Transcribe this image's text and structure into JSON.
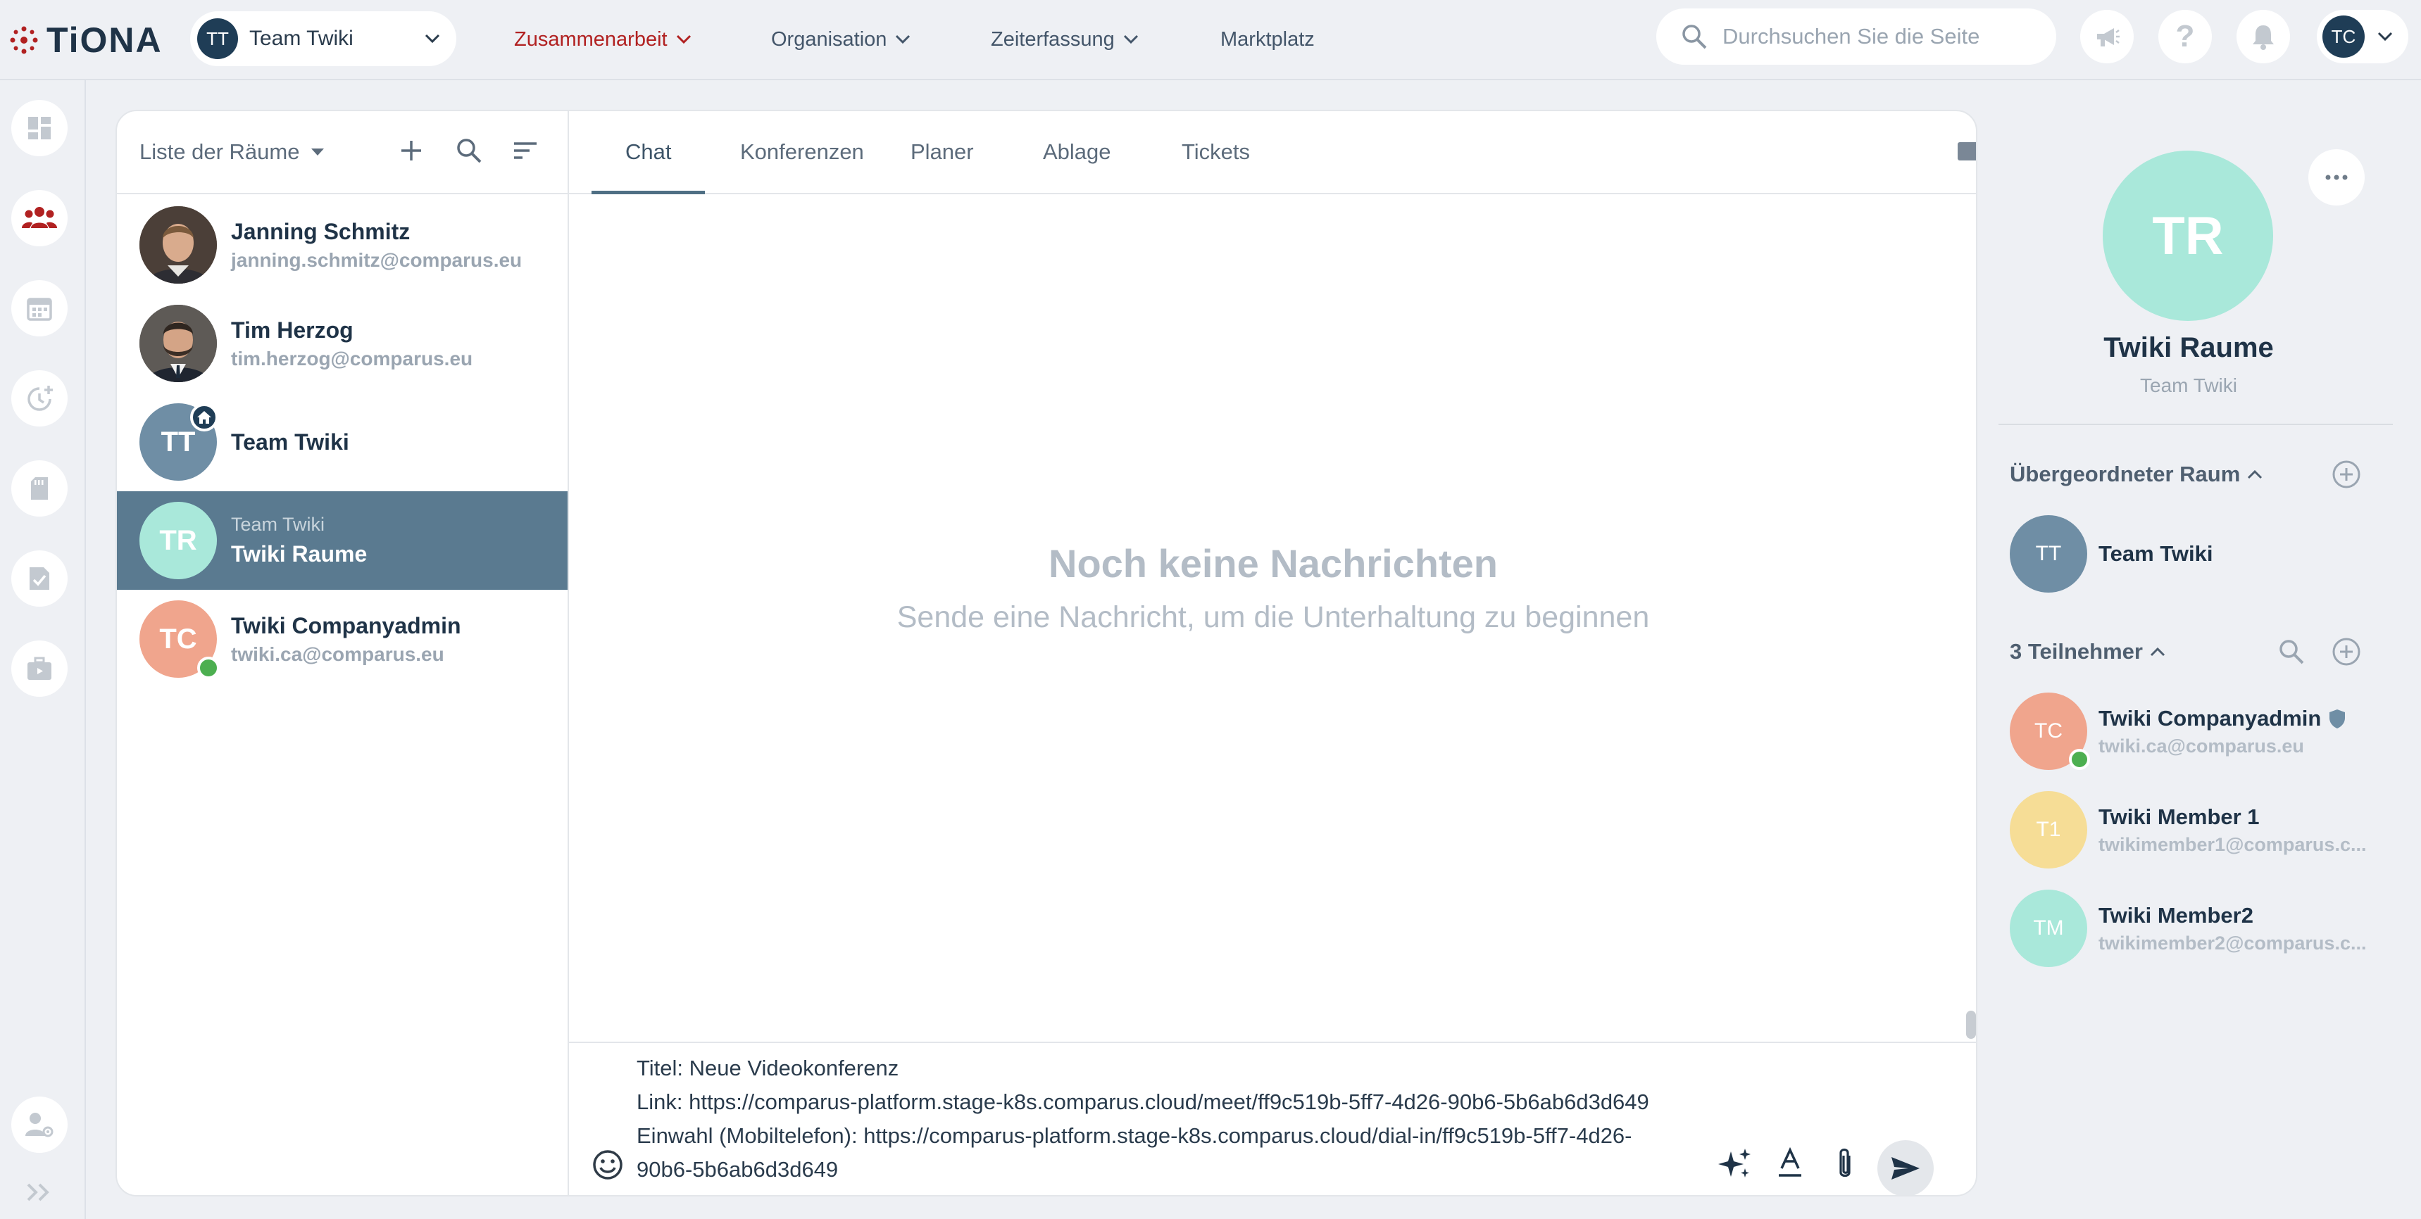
{
  "app": {
    "logo_text": "TiONA"
  },
  "header": {
    "team_select": {
      "avatar_initials": "TT",
      "label": "Team Twiki"
    },
    "nav": [
      {
        "label": "Zusammenarbeit"
      },
      {
        "label": "Organisation"
      },
      {
        "label": "Zeiterfassung"
      },
      {
        "label": "Marktplatz"
      }
    ],
    "search": {
      "placeholder": "Durchsuchen Sie die Seite",
      "value": ""
    },
    "user": {
      "initials": "TC"
    },
    "icons": [
      "megaphone-icon",
      "help-icon",
      "bell-icon"
    ]
  },
  "colors": {
    "accent": "#b12121",
    "selected_room": "#5a7a90",
    "dark_navy": "#1f3d56",
    "online": "#4caf50",
    "teal_avatar": "#a9e8da",
    "salmon_avatar": "#f0a58d",
    "slate_avatar": "#6f8ea5",
    "yellow_avatar": "#f6dd96"
  },
  "sidebar_rail": {
    "items": [
      "dashboard-icon",
      "collaboration-icon",
      "calendar-icon",
      "time-tracking-icon",
      "documents-icon",
      "tasks-icon",
      "briefcase-icon",
      "user-settings-icon",
      "expand-icon"
    ]
  },
  "rooms": {
    "header": {
      "title": "Liste der Räume"
    },
    "items": [
      {
        "name": "Janning Schmitz",
        "sub": "janning.schmitz@comparus.eu",
        "type": "photo"
      },
      {
        "name": "Tim Herzog",
        "sub": "tim.herzog@comparus.eu",
        "type": "photo"
      },
      {
        "name": "Team Twiki",
        "initials": "TT"
      },
      {
        "name": "Twiki Raume",
        "parent": "Team Twiki",
        "initials": "TR",
        "selected": true
      },
      {
        "name": "Twiki Companyadmin",
        "sub": "twiki.ca@comparus.eu",
        "initials": "TC",
        "online": true
      }
    ]
  },
  "chat": {
    "tabs": [
      {
        "label": "Chat"
      },
      {
        "label": "Konferenzen"
      },
      {
        "label": "Planer"
      },
      {
        "label": "Ablage"
      },
      {
        "label": "Tickets"
      }
    ],
    "empty": {
      "heading": "Noch keine Nachrichten",
      "subheading": "Sende eine Nachricht, um die Unterhaltung zu beginnen"
    },
    "composer": {
      "lines": [
        "Titel: Neue Videokonferenz",
        "Link: https://comparus-platform.stage-k8s.comparus.cloud/meet/ff9c519b-5ff7-4d26-90b6-5b6ab6d3d649",
        "Einwahl (Mobiltelefon): https://comparus-platform.stage-k8s.comparus.cloud/dial-in/ff9c519b-5ff7-4d26-",
        "90b6-5b6ab6d3d649"
      ]
    }
  },
  "details": {
    "avatar_initials": "TR",
    "title": "Twiki Raume",
    "subtitle": "Team Twiki",
    "parent_section": {
      "title": "Übergeordneter Raum",
      "room": {
        "initials": "TT",
        "name": "Team Twiki"
      }
    },
    "members_section": {
      "title": "3 Teilnehmer",
      "members": [
        {
          "initials": "TC",
          "name": "Twiki Companyadmin",
          "sub": "twiki.ca@comparus.eu",
          "online": true,
          "admin": true
        },
        {
          "initials": "T1",
          "name": "Twiki Member 1",
          "sub": "twikimember1@comparus.c..."
        },
        {
          "initials": "TM",
          "name": "Twiki Member2",
          "sub": "twikimember2@comparus.c..."
        }
      ]
    }
  }
}
